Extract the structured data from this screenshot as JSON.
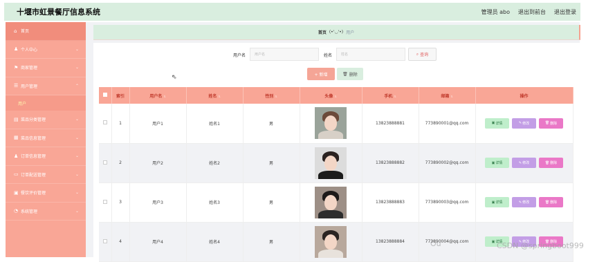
{
  "app": {
    "title": "十堰市虹景餐厅信息系统",
    "top_actions": [
      "管理员 abo",
      "退出到前台",
      "退出登录"
    ]
  },
  "sidebar": {
    "items": [
      {
        "label": "首页",
        "icon": "home-icon",
        "glyph": "⌂",
        "chevron": false
      },
      {
        "label": "个人中心",
        "icon": "person-icon",
        "glyph": "♟",
        "chevron": true
      },
      {
        "label": "商家管理",
        "icon": "flag-icon",
        "glyph": "⚑",
        "chevron": true
      },
      {
        "label": "用户管理",
        "icon": "list-icon",
        "glyph": "☰",
        "chevron": true,
        "expanded": true,
        "sub": "用户"
      },
      {
        "label": "菜品分类管理",
        "icon": "category-icon",
        "glyph": "▤",
        "chevron": true
      },
      {
        "label": "菜品信息管理",
        "icon": "food-icon",
        "glyph": "▦",
        "chevron": true
      },
      {
        "label": "订单信息管理",
        "icon": "order-icon",
        "glyph": "♟",
        "chevron": true
      },
      {
        "label": "订单配送管理",
        "icon": "delivery-icon",
        "glyph": "▭",
        "chevron": true
      },
      {
        "label": "餐饮评价管理",
        "icon": "review-icon",
        "glyph": "▣",
        "chevron": true
      },
      {
        "label": "系统管理",
        "icon": "settings-icon",
        "glyph": "◔",
        "chevron": true
      }
    ]
  },
  "breadcrumb": {
    "home": "首页",
    "face": "(•'◡'•)",
    "current": "用户"
  },
  "search": {
    "username_label": "用户名",
    "username_placeholder": "用户名",
    "name_label": "姓名",
    "name_placeholder": "姓名",
    "query_button": "查询"
  },
  "toolbar": {
    "add_button": "+ 新增",
    "delete_button": "删除"
  },
  "table": {
    "columns": [
      "索引",
      "用户名",
      "姓名",
      "性别",
      "头像",
      "手机",
      "邮箱",
      "操作"
    ],
    "rows": [
      {
        "index": "1",
        "username": "用户1",
        "name": "姓名1",
        "gender": "男",
        "phone": "13823888881",
        "email": "773890001@qq.com",
        "avatar": {
          "hair": "#6b4a3a",
          "body": "#d7d0c7",
          "bg": "#9aa39a"
        }
      },
      {
        "index": "2",
        "username": "用户2",
        "name": "姓名2",
        "gender": "男",
        "phone": "13823888882",
        "email": "773890002@qq.com",
        "avatar": {
          "hair": "#2a2220",
          "body": "#1c1c1c",
          "bg": "#dcdcdc"
        }
      },
      {
        "index": "3",
        "username": "用户3",
        "name": "姓名3",
        "gender": "男",
        "phone": "13823888883",
        "email": "773890003@qq.com",
        "avatar": {
          "hair": "#1d1a19",
          "body": "#2d2d2d",
          "bg": "#9d8f86"
        }
      },
      {
        "index": "4",
        "username": "用户4",
        "name": "姓名4",
        "gender": "男",
        "phone": "13823888884",
        "email": "773890004@qq.com",
        "avatar": {
          "hair": "#2a2422",
          "body": "#e8e2dc",
          "bg": "#b8a89c"
        }
      }
    ],
    "actions": {
      "detail": "详情",
      "edit": "修改",
      "delete": "删除"
    }
  },
  "watermark": {
    "left": "Ou",
    "right": "CSDN @springboot999"
  }
}
